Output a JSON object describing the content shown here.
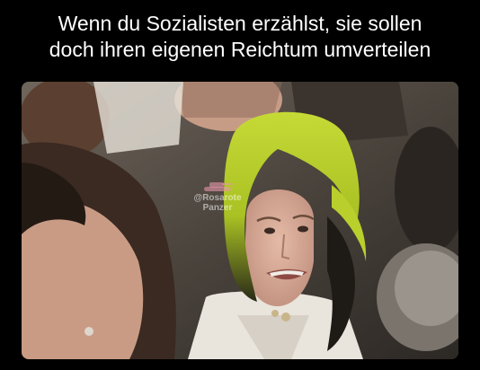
{
  "caption": {
    "text": "Wenn du Sozialisten erzählst, sie sollen\ndoch ihren eigenen Reichtum umverteilen",
    "color": "#ffffff"
  },
  "photo": {
    "watermark_handle": "@Rosarote",
    "watermark_name": "Panzer",
    "watermark_icon": "tank-icon"
  },
  "colors": {
    "background": "#000000",
    "hair_green": "#b9cf2c",
    "hair_dark": "#1e1b16",
    "skin": "#d8ad97"
  }
}
